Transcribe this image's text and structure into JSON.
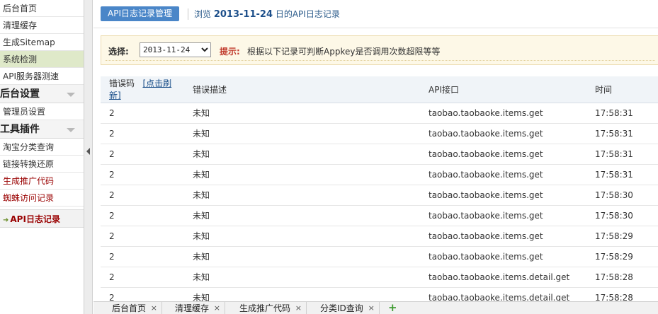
{
  "sidebar": {
    "items_top": [
      "后台首页",
      "清理缓存",
      "生成Sitemap",
      "系统检测",
      "API服务器测速"
    ],
    "group_settings": "后台设置",
    "items_settings": [
      "管理员设置"
    ],
    "group_tools": "工具插件",
    "items_tools": [
      "淘宝分类查询",
      "链接转换还原",
      "生成推广代码",
      "蜘蛛访问记录"
    ],
    "current": "API日志记录"
  },
  "header": {
    "badge": "API日志记录管理",
    "browse_prefix": "浏览",
    "date": "2013-11-24",
    "browse_suffix": "日的API日志记录"
  },
  "filter": {
    "label": "选择:",
    "selected_date": "2013-11-24",
    "tip_label": "提示:",
    "tip_text": "根据以下记录可判断Appkey是否调用次数超限等等"
  },
  "table": {
    "columns": [
      "错误码",
      "[点击刷新]",
      "错误描述",
      "API接口",
      "时间"
    ],
    "rows": [
      [
        "2",
        "未知",
        "taobao.taobaoke.items.get",
        "17:58:31"
      ],
      [
        "2",
        "未知",
        "taobao.taobaoke.items.get",
        "17:58:31"
      ],
      [
        "2",
        "未知",
        "taobao.taobaoke.items.get",
        "17:58:31"
      ],
      [
        "2",
        "未知",
        "taobao.taobaoke.items.get",
        "17:58:31"
      ],
      [
        "2",
        "未知",
        "taobao.taobaoke.items.get",
        "17:58:30"
      ],
      [
        "2",
        "未知",
        "taobao.taobaoke.items.get",
        "17:58:30"
      ],
      [
        "2",
        "未知",
        "taobao.taobaoke.items.get",
        "17:58:29"
      ],
      [
        "2",
        "未知",
        "taobao.taobaoke.items.get",
        "17:58:29"
      ],
      [
        "2",
        "未知",
        "taobao.taobaoke.items.detail.get",
        "17:58:28"
      ],
      [
        "2",
        "未知",
        "taobao.taobaoke.items.detail.get",
        "17:58:28"
      ]
    ]
  },
  "bottom_tabs": [
    "后台首页",
    "清理缓存",
    "生成推广代码",
    "分类ID查询"
  ],
  "bottom_add": "+",
  "tab_close": "×",
  "icons": {
    "current_arrow": "➜",
    "group_chevron": "chevron-down-icon",
    "splitter_arrow": "collapse-left-icon"
  },
  "colors": {
    "badge_bg": "#4a86c8",
    "tip_red": "#c0392b",
    "active_item_bg": "#dfe9c9",
    "current_red": "#990000"
  }
}
